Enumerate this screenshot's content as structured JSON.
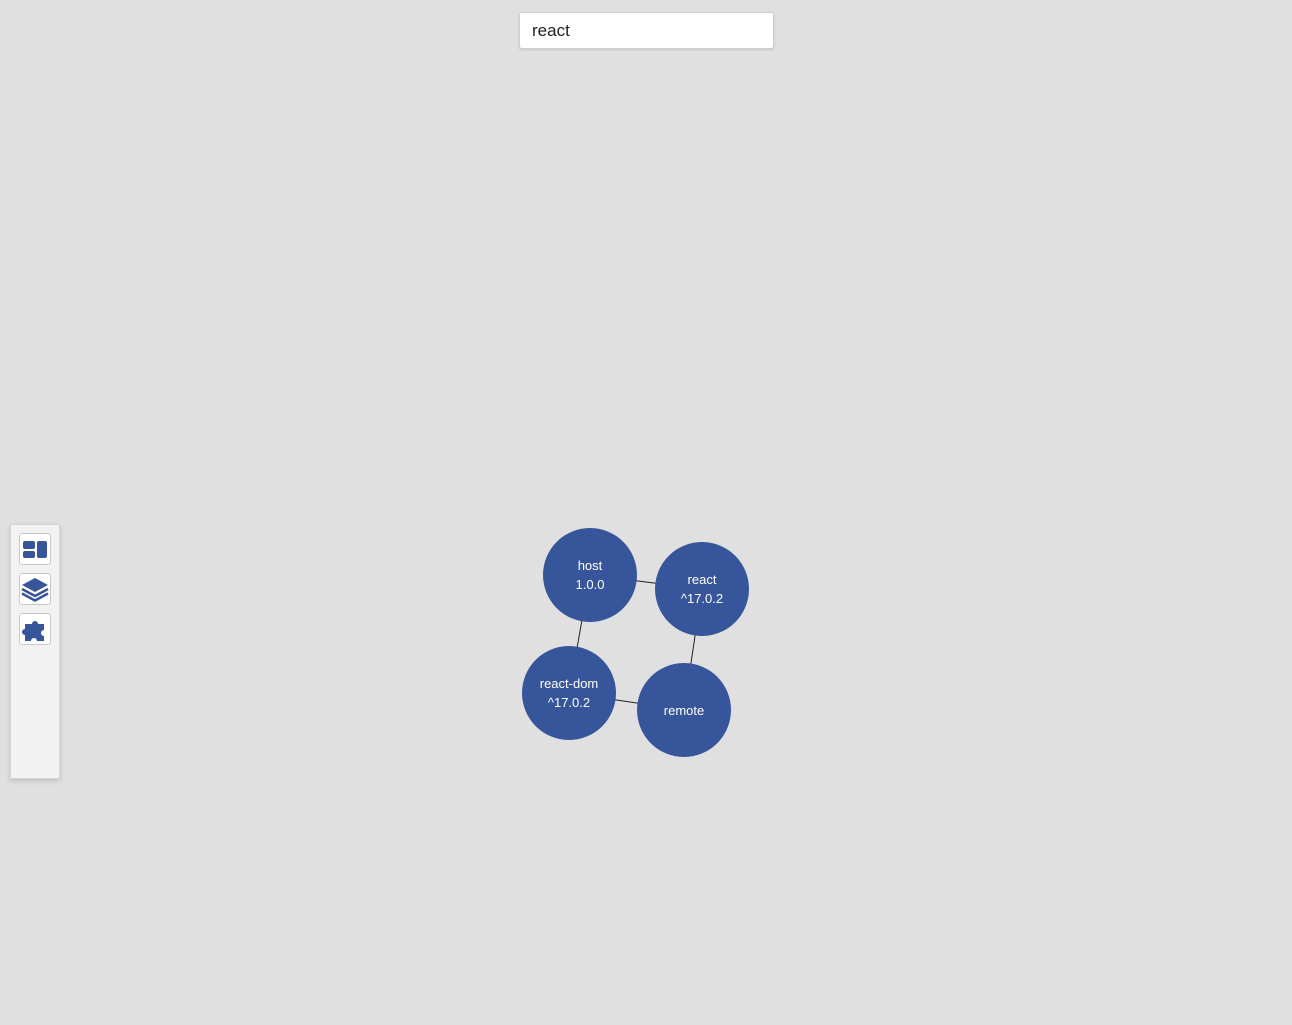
{
  "search": {
    "value": "react"
  },
  "toolbar": {
    "buttons": [
      {
        "icon": "dashboard-icon"
      },
      {
        "icon": "layers-icon"
      },
      {
        "icon": "puzzle-piece-icon"
      }
    ]
  },
  "graph": {
    "node_color": "#37559b",
    "edge_color": "#222222",
    "nodes": [
      {
        "id": "host",
        "name": "host",
        "version": "1.0.0"
      },
      {
        "id": "react",
        "name": "react",
        "version": "^17.0.2"
      },
      {
        "id": "react-dom",
        "name": "react-dom",
        "version": "^17.0.2"
      },
      {
        "id": "remote",
        "name": "remote",
        "version": ""
      }
    ],
    "edges": [
      [
        "host",
        "react"
      ],
      [
        "host",
        "react-dom"
      ],
      [
        "react",
        "remote"
      ],
      [
        "react-dom",
        "remote"
      ]
    ]
  }
}
